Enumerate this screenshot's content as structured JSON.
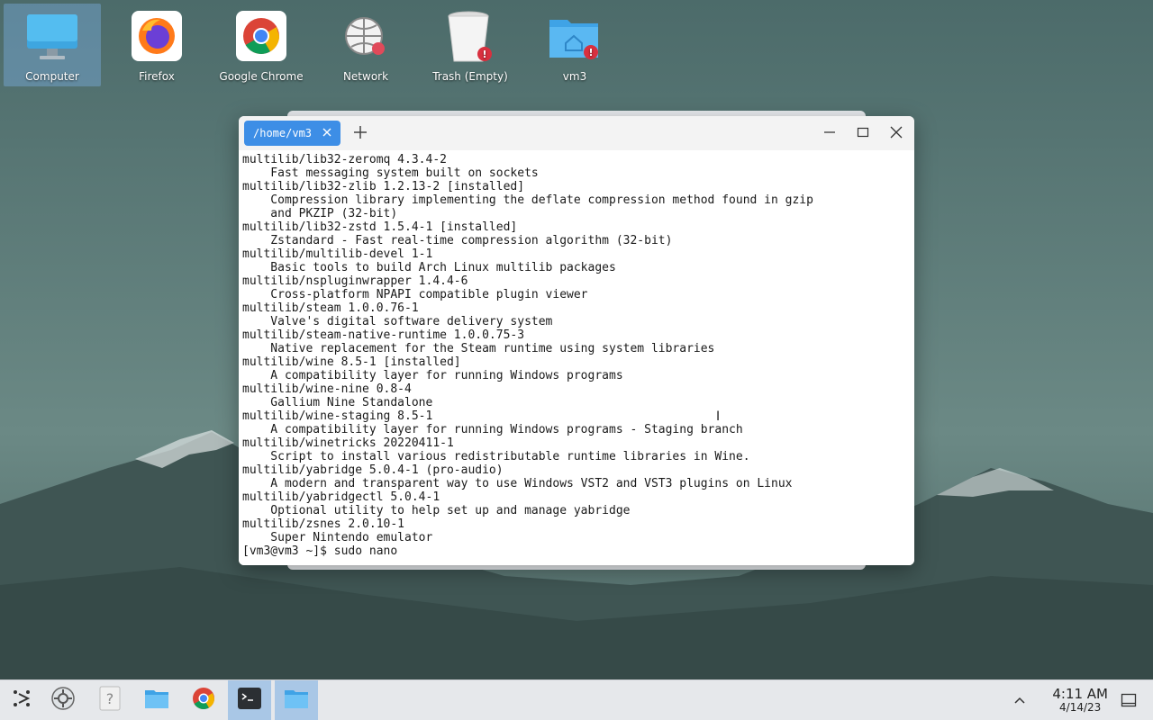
{
  "desktop": {
    "icons": [
      {
        "label": "Computer",
        "icon": "computer-icon"
      },
      {
        "label": "Firefox",
        "icon": "firefox-icon"
      },
      {
        "label": "Google Chrome",
        "icon": "chrome-icon"
      },
      {
        "label": "Network",
        "icon": "network-icon"
      },
      {
        "label": "Trash (Empty)",
        "icon": "trash-icon"
      },
      {
        "label": "vm3",
        "icon": "home-folder-icon"
      }
    ]
  },
  "terminal": {
    "tab_title": "/home/vm3",
    "lines": [
      "multilib/lib32-zeromq 4.3.4-2",
      "    Fast messaging system built on sockets",
      "multilib/lib32-zlib 1.2.13-2 [installed]",
      "    Compression library implementing the deflate compression method found in gzip",
      "    and PKZIP (32-bit)",
      "multilib/lib32-zstd 1.5.4-1 [installed]",
      "    Zstandard - Fast real-time compression algorithm (32-bit)",
      "multilib/multilib-devel 1-1",
      "    Basic tools to build Arch Linux multilib packages",
      "multilib/nspluginwrapper 1.4.4-6",
      "    Cross-platform NPAPI compatible plugin viewer",
      "multilib/steam 1.0.0.76-1",
      "    Valve's digital software delivery system",
      "multilib/steam-native-runtime 1.0.0.75-3",
      "    Native replacement for the Steam runtime using system libraries",
      "multilib/wine 8.5-1 [installed]",
      "    A compatibility layer for running Windows programs",
      "multilib/wine-nine 0.8-4",
      "    Gallium Nine Standalone",
      "multilib/wine-staging 8.5-1",
      "    A compatibility layer for running Windows programs - Staging branch",
      "multilib/winetricks 20220411-1",
      "    Script to install various redistributable runtime libraries in Wine.",
      "multilib/yabridge 5.0.4-1 (pro-audio)",
      "    A modern and transparent way to use Windows VST2 and VST3 plugins on Linux",
      "multilib/yabridgectl 5.0.4-1",
      "    Optional utility to help set up and manage yabridge",
      "multilib/zsnes 2.0.10-1",
      "    Super Nintendo emulator",
      "[vm3@vm3 ~]$ sudo nano"
    ]
  },
  "taskbar": {
    "items": [
      {
        "icon": "app-launcher-icon"
      },
      {
        "icon": "system-settings-icon"
      },
      {
        "icon": "help-icon"
      },
      {
        "icon": "file-manager-icon"
      },
      {
        "icon": "chrome-icon"
      },
      {
        "icon": "terminal-icon",
        "active": true
      },
      {
        "icon": "file-manager-icon",
        "active": true
      }
    ],
    "clock_time": "4:11 AM",
    "clock_date": "4/14/23"
  },
  "colors": {
    "accent": "#3d8ee6",
    "taskbar_bg": "#e6e8eb"
  }
}
